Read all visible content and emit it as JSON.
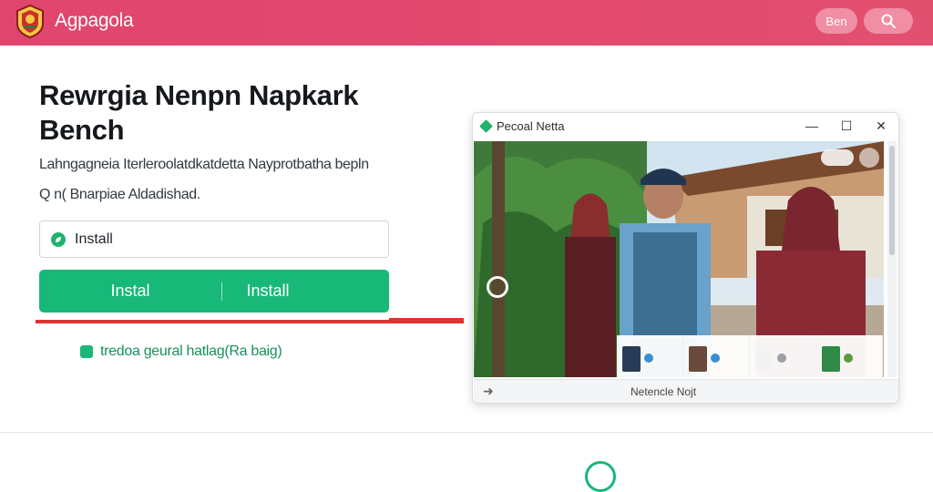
{
  "header": {
    "app_name": "Agpagola",
    "ben_label": "Ben",
    "search_icon": "search-icon",
    "logo": "crest-logo",
    "colors": {
      "bar": "#e0456e",
      "pill": "#ef8ea5"
    }
  },
  "main": {
    "title": "Rewrgia Nenpn Napkark Bench",
    "description": "Lahngagneia Iterleroolatdkatdetta Nayprotbatha bepln",
    "meta_text": "Q n( Bnarpiae Aldadishad.",
    "install_field": {
      "value": "Install",
      "icon": "leaf-icon"
    },
    "install_button": {
      "left_label": "Instal",
      "right_label": "Install",
      "color": "#17b878"
    },
    "link_text": "tredoa geural hatlag(Ra baig)",
    "link_icon": "bookmark-icon"
  },
  "window": {
    "title": "Pecoal Netta",
    "status_text": "Netencle Nojt",
    "controls": [
      "minimize-icon",
      "maximize-icon",
      "close-icon"
    ]
  }
}
